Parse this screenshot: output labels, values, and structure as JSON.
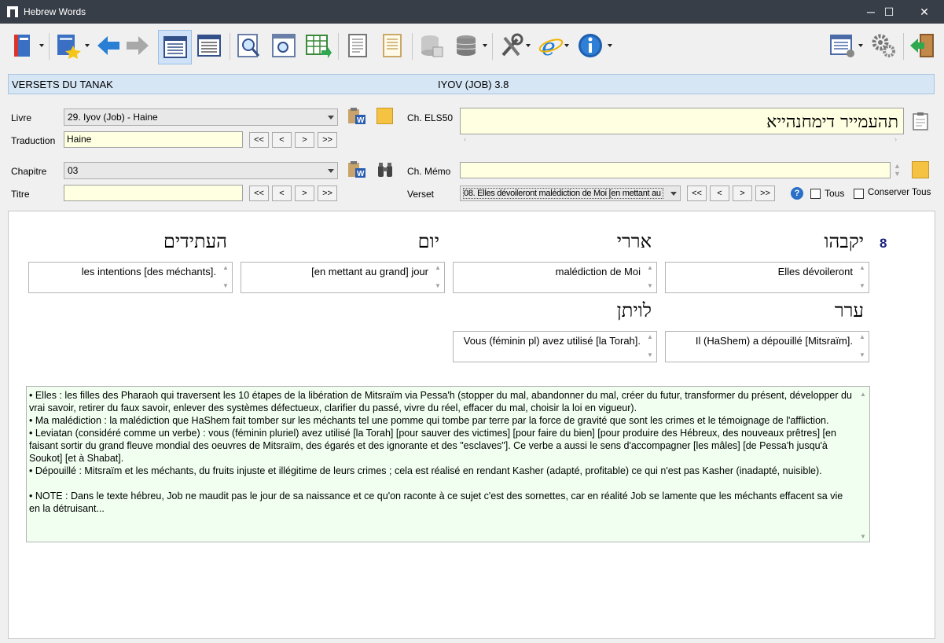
{
  "window": {
    "title": "Hebrew Words",
    "minimize": "─",
    "maximize": "☐",
    "close": "✕"
  },
  "toolbar": {
    "icons": [
      "book-icon",
      "bookmark-star-icon",
      "back-arrow-icon",
      "forward-arrow-icon",
      "grid-view-icon",
      "list-view-icon",
      "search-doc-icon",
      "preview-icon",
      "export-table-icon",
      "document-icon",
      "notes-icon",
      "database-icon",
      "database-menu-icon",
      "tools-icon",
      "web-icon",
      "info-icon",
      "settings-list-icon",
      "gear-icon",
      "exit-icon"
    ]
  },
  "header": {
    "left": "VERSETS DU TANAK",
    "center": "IYOV (JOB) 3.8"
  },
  "form": {
    "livre_label": "Livre",
    "livre_value": "29. Iyov (Job) - Haine",
    "traduction_label": "Traduction",
    "traduction_value": "Haine",
    "chapitre_label": "Chapitre",
    "chapitre_value": "03",
    "titre_label": "Titre",
    "titre_value": "",
    "els_label": "Ch. ELS50",
    "els_value": "תהעמייר דימחנהייא",
    "memo_label": "Ch. Mémo",
    "memo_value": "",
    "verset_label": "Verset",
    "verset_value": "08. Elles dévoileront malédiction de Moi [en mettant au",
    "nav": [
      "<<",
      "<",
      ">",
      ">>"
    ],
    "tous_label": "Tous",
    "conserver_label": "Conserver Tous"
  },
  "verse": {
    "number": "8",
    "words": [
      {
        "hebrew": "יקבהו",
        "translation": "Elles dévoileront"
      },
      {
        "hebrew": "אררי",
        "translation": "malédiction de Moi"
      },
      {
        "hebrew": "יום",
        "translation": "[en mettant au grand] jour"
      },
      {
        "hebrew": "העתידים",
        "translation": "les intentions [des méchants]."
      },
      {
        "hebrew": "ערר",
        "translation": "Il (HaShem) a dépouillé [Mitsraïm]."
      },
      {
        "hebrew": "לויתן",
        "translation": "Vous (féminin pl) avez utilisé [la Torah]."
      }
    ]
  },
  "notes": [
    "• Elles : les filles des Pharaoh qui traversent les 10 étapes de la libération de Mitsraïm via Pessa'h (stopper du mal, abandonner du mal, créer du futur, transformer du présent, développer du vrai savoir, retirer du faux savoir, enlever des systèmes défectueux, clarifier du passé, vivre du réel, effacer du mal, choisir la loi en vigueur).",
    "• Ma malédiction : la malédiction que HaShem fait tomber sur les méchants tel une pomme qui tombe par terre par la force de gravité que sont les crimes et le témoignage de l'affliction.",
    "• Leviatan (considéré comme un verbe) : vous (féminin pluriel) avez utilisé [la Torah] [pour sauver des victimes] [pour faire du bien] [pour produire des Hébreux, des nouveaux prêtres] [en faisant sortir du grand fleuve mondial des oeuvres de Mitsraïm, des égarés et des ignorante et des \"esclaves\"]. Ce verbe a aussi le sens d'accompagner [les mâles] [de Pessa'h jusqu'à Soukot] [et à Shabat].",
    "• Dépouillé : Mitsraïm et les méchants, du fruits injuste et illégitime de leurs crimes ; cela est réalisé en rendant Kasher (adapté, profitable) ce qui n'est pas Kasher (inadapté, nuisible).",
    "",
    "• NOTE : Dans le texte hébreu, Job ne maudit pas le jour de sa naissance et ce qu'on raconte à ce sujet c'est des sornettes, car en réalité Job se lamente que les méchants effacent sa vie en la détruisant..."
  ]
}
